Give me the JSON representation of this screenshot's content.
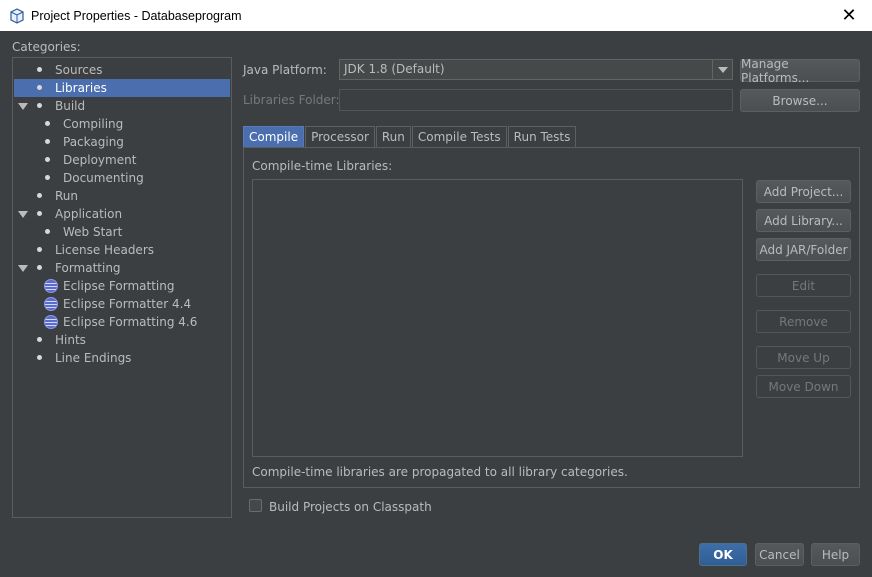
{
  "window": {
    "title": "Project Properties - Databaseprogram"
  },
  "categories": {
    "label": "Categories:",
    "items": [
      {
        "label": "Sources",
        "level": 0,
        "kind": "leaf"
      },
      {
        "label": "Libraries",
        "level": 0,
        "kind": "leaf",
        "selected": true
      },
      {
        "label": "Build",
        "level": 0,
        "kind": "expanded"
      },
      {
        "label": "Compiling",
        "level": 1,
        "kind": "leaf"
      },
      {
        "label": "Packaging",
        "level": 1,
        "kind": "leaf"
      },
      {
        "label": "Deployment",
        "level": 1,
        "kind": "leaf"
      },
      {
        "label": "Documenting",
        "level": 1,
        "kind": "leaf"
      },
      {
        "label": "Run",
        "level": 0,
        "kind": "leaf"
      },
      {
        "label": "Application",
        "level": 0,
        "kind": "expanded"
      },
      {
        "label": "Web Start",
        "level": 1,
        "kind": "leaf"
      },
      {
        "label": "License Headers",
        "level": 0,
        "kind": "leaf"
      },
      {
        "label": "Formatting",
        "level": 0,
        "kind": "expanded"
      },
      {
        "label": "Eclipse Formatting",
        "level": 1,
        "kind": "globe"
      },
      {
        "label": "Eclipse Formatter 4.4",
        "level": 1,
        "kind": "globe"
      },
      {
        "label": "Eclipse Formatting 4.6",
        "level": 1,
        "kind": "globe"
      },
      {
        "label": "Hints",
        "level": 0,
        "kind": "leaf"
      },
      {
        "label": "Line Endings",
        "level": 0,
        "kind": "leaf"
      }
    ]
  },
  "platform": {
    "label": "Java Platform:",
    "value": "JDK 1.8 (Default)",
    "manage_button": "Manage Platforms..."
  },
  "libraries_folder": {
    "label": "Libraries Folder:",
    "value": "",
    "browse_button": "Browse..."
  },
  "tabs": [
    {
      "label": "Compile",
      "active": true
    },
    {
      "label": "Processor"
    },
    {
      "label": "Run"
    },
    {
      "label": "Compile Tests"
    },
    {
      "label": "Run Tests"
    }
  ],
  "compile": {
    "list_label": "Compile-time Libraries:",
    "footer": "Compile-time libraries are propagated to all library categories.",
    "buttons": {
      "add_project": "Add Project...",
      "add_library": "Add Library...",
      "add_jar": "Add JAR/Folder",
      "edit": "Edit",
      "remove": "Remove",
      "move_up": "Move Up",
      "move_down": "Move Down"
    }
  },
  "build_on_classpath": {
    "label": "Build Projects on Classpath",
    "checked": false
  },
  "footer": {
    "ok": "OK",
    "cancel": "Cancel",
    "help": "Help"
  },
  "colors": {
    "selection": "#4b6eaf",
    "background": "#3c3f41",
    "text": "#bbbbbb"
  }
}
